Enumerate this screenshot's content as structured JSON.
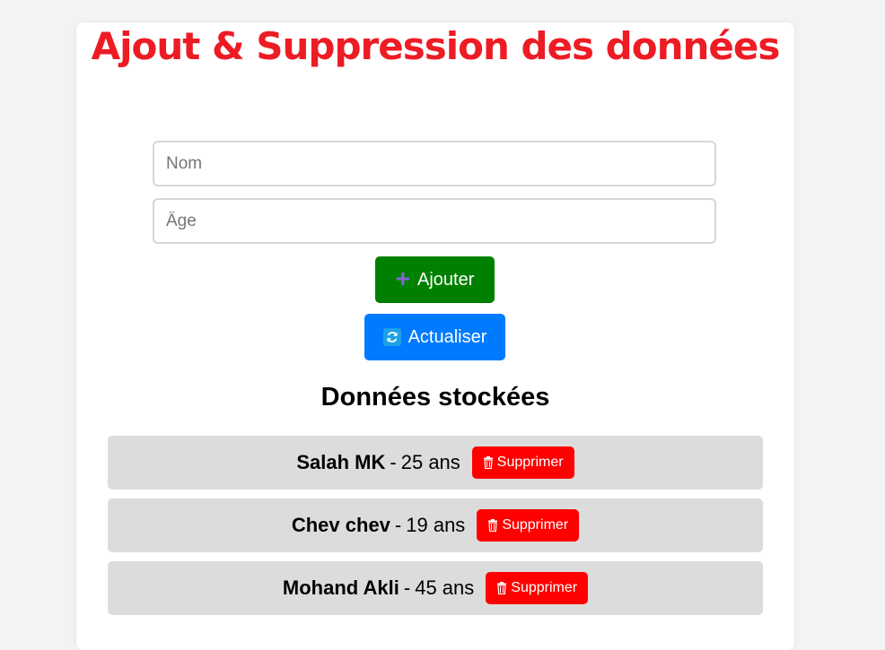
{
  "header": {
    "title": "Ajout & Suppression des données"
  },
  "form": {
    "name_placeholder": "Nom",
    "name_value": "",
    "age_placeholder": "Âge",
    "age_value": "",
    "add_icon": "plus-icon",
    "add_label": "Ajouter",
    "refresh_icon": "refresh-icon",
    "refresh_label": "Actualiser"
  },
  "list": {
    "title": "Données stockées",
    "separator": "-",
    "delete_icon": "trash-icon",
    "items": [
      {
        "name": "Salah MK",
        "age": "25 ans",
        "delete_label": "Supprimer"
      },
      {
        "name": "Chev chev",
        "age": "19 ans",
        "delete_label": "Supprimer"
      },
      {
        "name": "Mohand Akli",
        "age": "45 ans",
        "delete_label": "Supprimer"
      }
    ]
  },
  "colors": {
    "page_background": "#f3f3f3",
    "title": "#ed1c24",
    "add_button": "#008000",
    "refresh_button": "#007bff",
    "row_background": "#dcdcdc",
    "delete_button": "#ff0000"
  }
}
